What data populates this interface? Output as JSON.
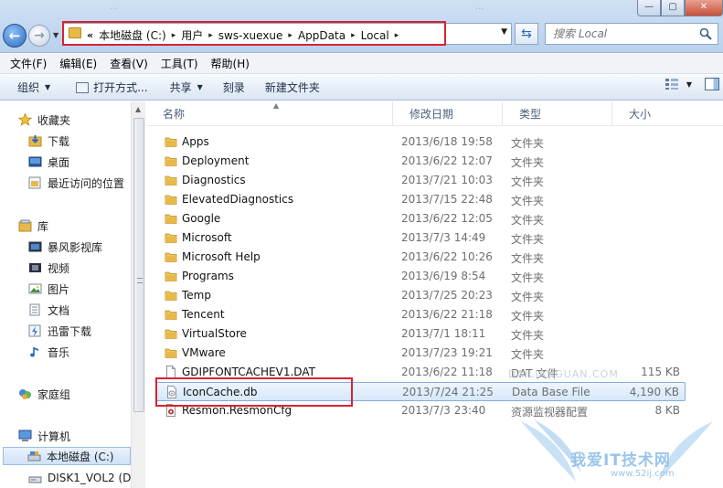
{
  "window": {
    "title_blur": [
      "...",
      "..."
    ],
    "buttons": {
      "minimize": "—",
      "maximize": "▢",
      "close": "✕"
    }
  },
  "address": {
    "lead": "«",
    "crumbs": [
      "本地磁盘 (C:)",
      "用户",
      "sws-xuexue",
      "AppData",
      "Local"
    ],
    "separator": "▸"
  },
  "search": {
    "placeholder": "搜索 Local"
  },
  "menu": [
    "文件(F)",
    "编辑(E)",
    "查看(V)",
    "工具(T)",
    "帮助(H)"
  ],
  "toolbar": {
    "organize": "组织",
    "open_with": "打开方式...",
    "share": "共享",
    "burn": "刻录",
    "new_folder": "新建文件夹"
  },
  "nav": {
    "favorites": "收藏夹",
    "downloads": "下载",
    "desktop": "桌面",
    "recent": "最近访问的位置",
    "libraries": "库",
    "baofeng": "暴风影视库",
    "videos": "视频",
    "pictures": "图片",
    "documents": "文档",
    "thunder": "迅雷下载",
    "music": "音乐",
    "homegroup": "家庭组",
    "computer": "计算机",
    "local_disk": "本地磁盘 (C:)",
    "disk1": "DISK1_VOL2 (D"
  },
  "columns": {
    "name": "名称",
    "date": "修改日期",
    "type": "类型",
    "size": "大小"
  },
  "files": [
    {
      "name": "Apps",
      "date": "2013/6/18 19:58",
      "type": "文件夹",
      "size": "",
      "kind": "folder"
    },
    {
      "name": "Deployment",
      "date": "2013/6/22 12:07",
      "type": "文件夹",
      "size": "",
      "kind": "folder"
    },
    {
      "name": "Diagnostics",
      "date": "2013/7/21 10:03",
      "type": "文件夹",
      "size": "",
      "kind": "folder"
    },
    {
      "name": "ElevatedDiagnostics",
      "date": "2013/7/15 22:48",
      "type": "文件夹",
      "size": "",
      "kind": "folder"
    },
    {
      "name": "Google",
      "date": "2013/6/22 12:05",
      "type": "文件夹",
      "size": "",
      "kind": "folder"
    },
    {
      "name": "Microsoft",
      "date": "2013/7/3 14:49",
      "type": "文件夹",
      "size": "",
      "kind": "folder"
    },
    {
      "name": "Microsoft Help",
      "date": "2013/6/22 10:26",
      "type": "文件夹",
      "size": "",
      "kind": "folder"
    },
    {
      "name": "Programs",
      "date": "2013/6/19 8:54",
      "type": "文件夹",
      "size": "",
      "kind": "folder"
    },
    {
      "name": "Temp",
      "date": "2013/7/25 20:23",
      "type": "文件夹",
      "size": "",
      "kind": "folder"
    },
    {
      "name": "Tencent",
      "date": "2013/6/22 21:18",
      "type": "文件夹",
      "size": "",
      "kind": "folder"
    },
    {
      "name": "VirtualStore",
      "date": "2013/7/1 18:11",
      "type": "文件夹",
      "size": "",
      "kind": "folder"
    },
    {
      "name": "VMware",
      "date": "2013/7/23 19:21",
      "type": "文件夹",
      "size": "",
      "kind": "folder"
    },
    {
      "name": "GDIPFONTCACHEV1.DAT",
      "date": "2013/6/22 11:18",
      "type": "DAT 文件",
      "size": "115 KB",
      "kind": "file"
    },
    {
      "name": "IconCache.db",
      "date": "2013/7/24 21:25",
      "type": "Data Base File",
      "size": "4,190 KB",
      "kind": "db",
      "selected": true
    },
    {
      "name": "Resmon.ResmonCfg",
      "date": "2013/7/3 23:40",
      "type": "资源监视器配置",
      "size": "8 KB",
      "kind": "cfg"
    }
  ],
  "watermark": {
    "text": "我爱IT技术网",
    "url": "www.52ij.com",
    "faint": "DAILIANGUAN.COM"
  },
  "colors": {
    "highlight_red": "#d9232e",
    "folder": "#e8b94a",
    "selection": "#84acdd"
  }
}
